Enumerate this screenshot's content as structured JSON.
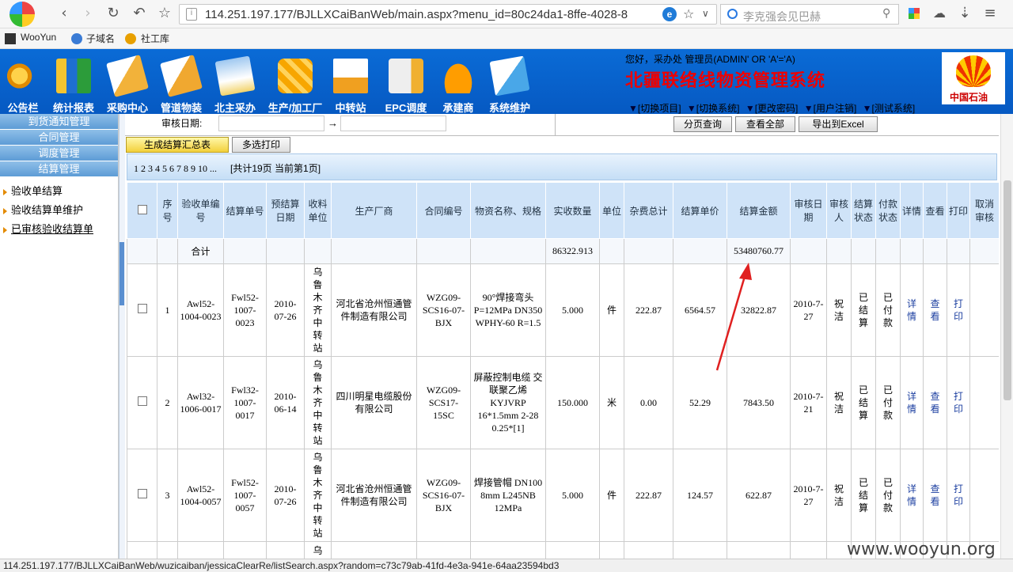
{
  "browser": {
    "url": "114.251.197.177/BJLLXCaiBanWeb/main.aspx?menu_id=80c24da1-8ffe-4028-8",
    "url_host": "114.251.197.177",
    "search_placeholder": "李克强会见巴赫",
    "bookmarks": [
      "WooYun",
      "子域名",
      "社工库"
    ]
  },
  "header": {
    "menu": [
      "公告栏",
      "统计报表",
      "采购中心",
      "管道物装",
      "北主采办",
      "生产/加工厂",
      "中转站",
      "EPC调度",
      "承建商",
      "系统维护"
    ],
    "greeting": "您好，采办处 管理员(ADMIN' OR 'A'='A)",
    "title": "北疆联络线物资管理系统",
    "links": [
      "[切换项目]",
      "[切换系统]",
      "[更改密码]",
      "[用户注销]",
      "[测试系统]"
    ],
    "logo_text": "中国石油"
  },
  "sidebar": {
    "heads": [
      "到货通知管理",
      "合同管理",
      "调度管理",
      "结算管理"
    ],
    "items": [
      "验收单结算",
      "验收结算单维护",
      "已审核验收结算单"
    ]
  },
  "filter": {
    "label": "审核日期:",
    "arrow": "→",
    "buttons": [
      "分页查询",
      "查看全部",
      "导出到Excel"
    ]
  },
  "actions": [
    "生成结算汇总表",
    "多选打印"
  ],
  "pager": {
    "pages": "1 2 3 4 5 6 7 8 9 10 ...",
    "info": "[共计19页 当前第1页]"
  },
  "table": {
    "headers": [
      "序号",
      "验收单编号",
      "结算单号",
      "预结算日期",
      "收料单位",
      "生产厂商",
      "合同编号",
      "物资名称、规格",
      "实收数量",
      "单位",
      "杂费总计",
      "结算单价",
      "结算金额",
      "审核日期",
      "审核人",
      "结算状态",
      "付款状态",
      "详情",
      "查看",
      "打印",
      "取消审核"
    ],
    "sum": {
      "label": "合计",
      "qty": "86322.913",
      "amount": "53480760.77"
    },
    "rows": [
      {
        "no": "1",
        "receipt": "Awl52-1004-0023",
        "settle": "Fwl52-1007-0023",
        "predate": "2010-07-26",
        "unit_org": "乌鲁木齐中转站",
        "maker": "河北省沧州恒通管件制造有限公司",
        "contract": "WZG09-SCS16-07-BJX",
        "material": "90°焊接弯头 P=12MPa DN350 WPHY-60 R=1.5",
        "qty": "5.000",
        "uom": "件",
        "fee": "222.87",
        "price": "6564.57",
        "amount": "32822.87",
        "audit_date": "2010-7-27",
        "auditor": "祝洁",
        "settle_state": "已结算",
        "pay_state": "已付款",
        "detail": "详情",
        "view": "查看",
        "print": "打印"
      },
      {
        "no": "2",
        "receipt": "Awl32-1006-0017",
        "settle": "Fwl32-1007-0017",
        "predate": "2010-06-14",
        "unit_org": "乌鲁木齐中转站",
        "maker": "四川明星电缆股份有限公司",
        "contract": "WZG09-SCS17-15SC",
        "material": "屏蔽控制电缆 交联聚乙烯 KYJVRP 16*1.5mm 2-28 0.25*[1]",
        "qty": "150.000",
        "uom": "米",
        "fee": "0.00",
        "price": "52.29",
        "amount": "7843.50",
        "audit_date": "2010-7-21",
        "auditor": "祝洁",
        "settle_state": "已结算",
        "pay_state": "已付款",
        "detail": "详情",
        "view": "查看",
        "print": "打印"
      },
      {
        "no": "3",
        "receipt": "Awl52-1004-0057",
        "settle": "Fwl52-1007-0057",
        "predate": "2010-07-26",
        "unit_org": "乌鲁木齐中转站",
        "maker": "河北省沧州恒通管件制造有限公司",
        "contract": "WZG09-SCS16-07-BJX",
        "material": "焊接管帽 DN100 8mm L245NB 12MPa",
        "qty": "5.000",
        "uom": "件",
        "fee": "222.87",
        "price": "124.57",
        "amount": "622.87",
        "audit_date": "2010-7-27",
        "auditor": "祝洁",
        "settle_state": "已结算",
        "pay_state": "已付款",
        "detail": "详情",
        "view": "查看",
        "print": "打印"
      }
    ],
    "partial_row_org": "乌"
  },
  "status_url": "114.251.197.177/BJLLXCaiBanWeb/wuzicaiban/jessicaClearRe/listSearch.aspx?random=c73c79ab-41fd-4e3a-941e-64aa23594bd3",
  "watermark": "www.wooyun.org",
  "colors": {
    "header_blue": "#0a6bd6",
    "title_red": "#e00000",
    "annotation_arrow": "#e02020"
  }
}
